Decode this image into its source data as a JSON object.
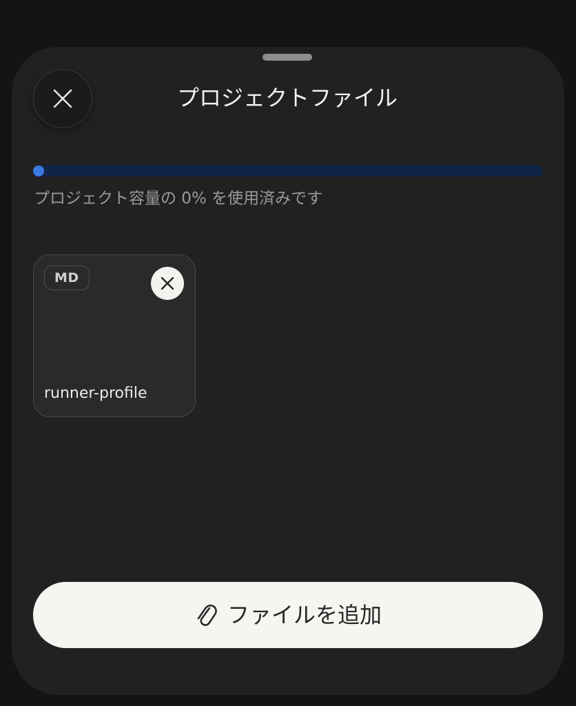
{
  "sheet": {
    "title": "プロジェクトファイル"
  },
  "storage": {
    "used_fraction": 0.0,
    "usage_text": "プロジェクト容量の 0% を使用済みです",
    "track_color": "#0f2548",
    "fill_color": "#3b78e0"
  },
  "files": [
    {
      "type": "MD",
      "name": "runner-profile"
    }
  ],
  "actions": {
    "add_file_label": "ファイルを追加"
  },
  "icons": {
    "close": "close-icon",
    "remove_file": "close-icon",
    "attach": "paperclip-icon"
  }
}
